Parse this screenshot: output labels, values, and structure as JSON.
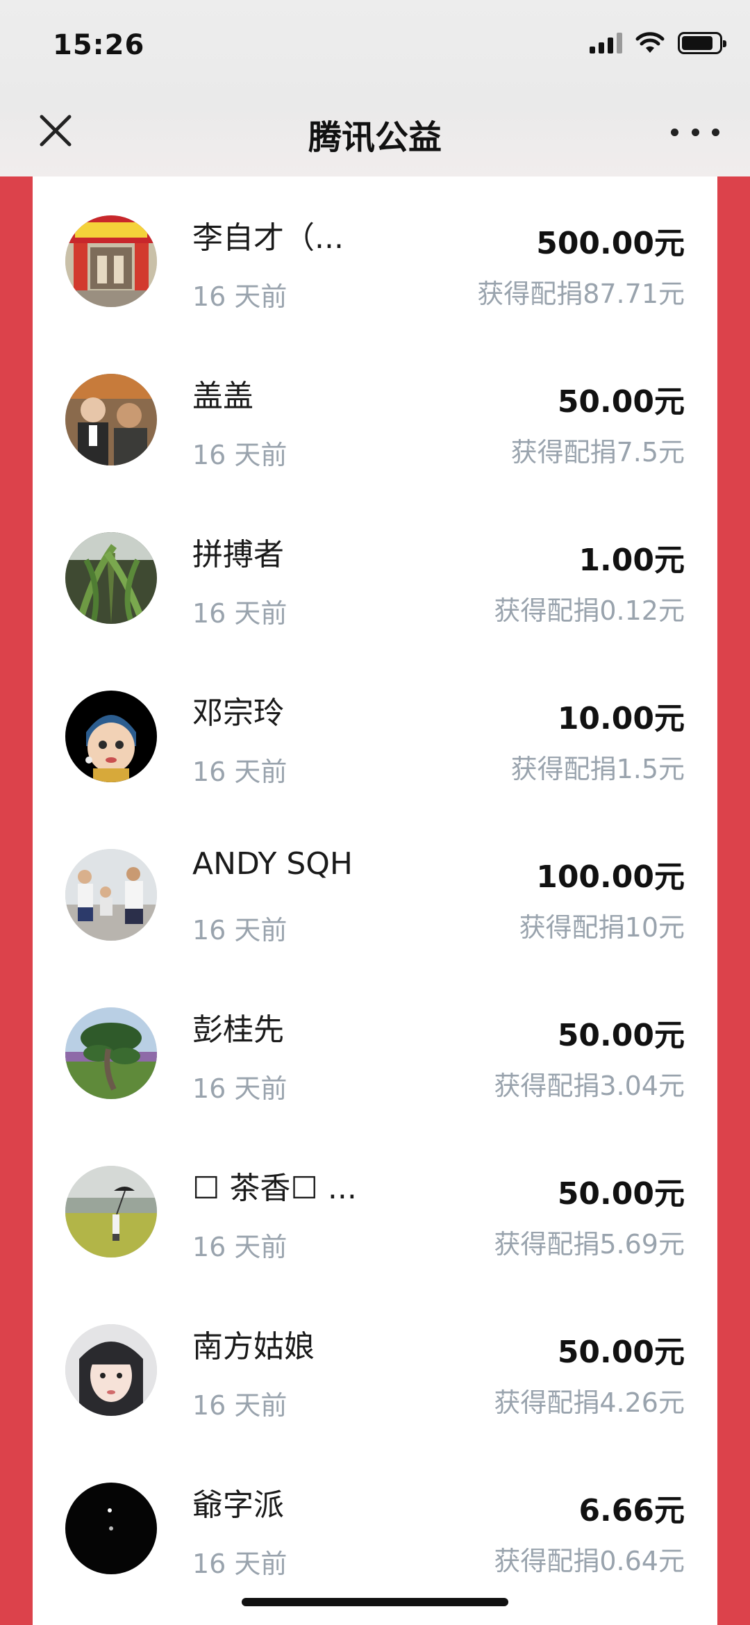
{
  "status_bar": {
    "time": "15:26"
  },
  "nav": {
    "title": "腾讯公益"
  },
  "donations": [
    {
      "name": "李自才（...",
      "time": "16 天前",
      "amount": "500.00元",
      "match": "获得配捐87.71元",
      "avatar": "shop-storefront-photo"
    },
    {
      "name": "盖盖",
      "time": "16 天前",
      "amount": "50.00元",
      "match": "获得配捐7.5元",
      "avatar": "two-men-photo"
    },
    {
      "name": "拼搏者",
      "time": "16 天前",
      "amount": "1.00元",
      "match": "获得配捐0.12元",
      "avatar": "green-plant-photo"
    },
    {
      "name": "邓宗玲",
      "time": "16 天前",
      "amount": "10.00元",
      "match": "获得配捐1.5元",
      "avatar": "cartoon-girl-pearl-earring"
    },
    {
      "name": "ANDY SQH",
      "time": "16 天前",
      "amount": "100.00元",
      "match": "获得配捐10元",
      "avatar": "family-running-photo"
    },
    {
      "name": "彭桂先",
      "time": "16 天前",
      "amount": "50.00元",
      "match": "获得配捐3.04元",
      "avatar": "bonsai-tree-photo"
    },
    {
      "name": "☐ 茶香☐ ...",
      "time": "16 天前",
      "amount": "50.00元",
      "match": "获得配捐5.69元",
      "avatar": "grassland-umbrella-photo"
    },
    {
      "name": "南方姑娘",
      "time": "16 天前",
      "amount": "50.00元",
      "match": "获得配捐4.26元",
      "avatar": "girl-selfie-photo"
    },
    {
      "name": "爺字派",
      "time": "16 天前",
      "amount": "6.66元",
      "match": "获得配捐0.64元",
      "avatar": "night-sky-moon-photo"
    }
  ]
}
